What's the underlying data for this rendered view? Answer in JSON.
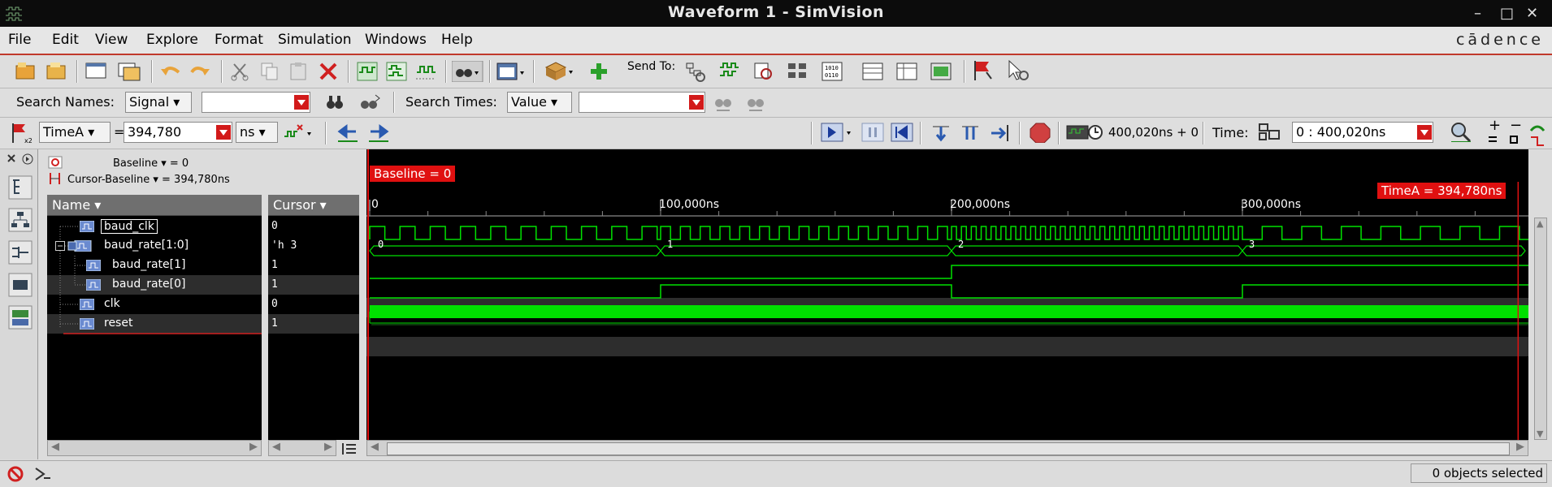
{
  "window": {
    "title": "Waveform 1 - SimVision",
    "minimize": "–",
    "maximize": "□",
    "close": "✕"
  },
  "menu": {
    "items": [
      "File",
      "Edit",
      "View",
      "Explore",
      "Format",
      "Simulation",
      "Windows",
      "Help"
    ],
    "brand": "cādence"
  },
  "toolbar1": {
    "send_to_label": "Send To:"
  },
  "search": {
    "names_label": "Search Names:",
    "names_mode": "Signal",
    "names_value": "",
    "times_label": "Search Times:",
    "times_mode": "Value",
    "times_value": ""
  },
  "cursor_bar": {
    "cursor_name": "TimeA",
    "equals": "=",
    "value": "394,780",
    "unit": "ns",
    "sim_time": "400,020ns + 0",
    "time_label": "Time:",
    "time_range": "0 : 400,020ns",
    "plus": "+",
    "minus": "−"
  },
  "baseline": {
    "baseline_text": "Baseline ▾ = 0",
    "cursor_baseline_text": "Cursor-Baseline ▾ = 394,780ns"
  },
  "columns": {
    "name": "Name ▾",
    "cursor": "Cursor ▾"
  },
  "signals": [
    {
      "name": "baud_clk",
      "cursor": "0"
    },
    {
      "name": "baud_rate[1:0]",
      "cursor": "'h 3"
    },
    {
      "name": "baud_rate[1]",
      "cursor": "1"
    },
    {
      "name": "baud_rate[0]",
      "cursor": "1"
    },
    {
      "name": "clk",
      "cursor": "0"
    },
    {
      "name": "reset",
      "cursor": "1"
    }
  ],
  "waveform": {
    "baseline_marker": "Baseline = 0",
    "cursor_marker": "TimeA = 394,780ns",
    "ticks": [
      "0",
      "100,000ns",
      "200,000ns",
      "300,000ns"
    ],
    "bus_values": [
      "0",
      "1",
      "2",
      "3"
    ],
    "colors": {
      "wave": "#00e000",
      "cursor": "#e01010",
      "background": "#000000"
    }
  },
  "status": {
    "text": "0 objects selected"
  }
}
